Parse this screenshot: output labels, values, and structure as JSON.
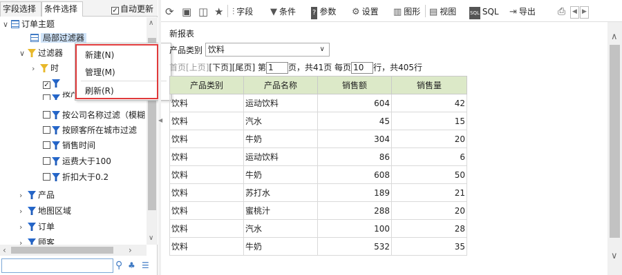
{
  "left_panel": {
    "tabs": [
      "字段选择",
      "条件选择"
    ],
    "auto_update": {
      "label": "自动更新",
      "checked": true
    },
    "tree": {
      "root": "订单主题",
      "local_filter": "局部过滤器",
      "filters_label": "过滤器",
      "time_node": "时",
      "partial_hidden": "按产品名称过滤",
      "items": [
        "按公司名称过滤（模糊",
        "按顾客所在城市过滤",
        "销售时间",
        "运费大于100",
        "折扣大于0.2"
      ],
      "groups": [
        "产品",
        "地图区域",
        "订单",
        "顾客"
      ]
    },
    "search": {
      "placeholder": ""
    }
  },
  "context_menu": {
    "items": [
      "新建(N)",
      "管理(M)",
      "刷新(R)"
    ]
  },
  "toolbar": {
    "buttons": [
      "字段",
      "条件",
      "参数",
      "设置",
      "图形",
      "视图",
      "SQL",
      "导出"
    ],
    "sql_badge": "SQL"
  },
  "report": {
    "title": "新报表",
    "filter_label": "产品类别",
    "filter_value": "饮料",
    "pager": {
      "first": "首页",
      "prev": "[上页]",
      "next": "[下页]",
      "last": "[尾页]",
      "page_prefix": " 第",
      "page_value": "1",
      "page_mid": "页，共41页 每页",
      "per_page_value": "10",
      "rows_suffix": "行，共405行"
    },
    "columns": [
      "产品类别",
      "产品名称",
      "销售额",
      "销售量"
    ],
    "rows": [
      [
        "饮料",
        "运动饮料",
        "604",
        "42"
      ],
      [
        "饮料",
        "汽水",
        "45",
        "15"
      ],
      [
        "饮料",
        "牛奶",
        "304",
        "20"
      ],
      [
        "饮料",
        "运动饮料",
        "86",
        "6"
      ],
      [
        "饮料",
        "牛奶",
        "608",
        "50"
      ],
      [
        "饮料",
        "苏打水",
        "189",
        "21"
      ],
      [
        "饮料",
        "蜜桃汁",
        "288",
        "20"
      ],
      [
        "饮料",
        "汽水",
        "100",
        "28"
      ],
      [
        "饮料",
        "牛奶",
        "532",
        "35"
      ]
    ]
  },
  "colors": {
    "header_bg": "#dce9c8",
    "menu_highlight": "#e0393a",
    "selected_bg": "#cfe3f8"
  }
}
